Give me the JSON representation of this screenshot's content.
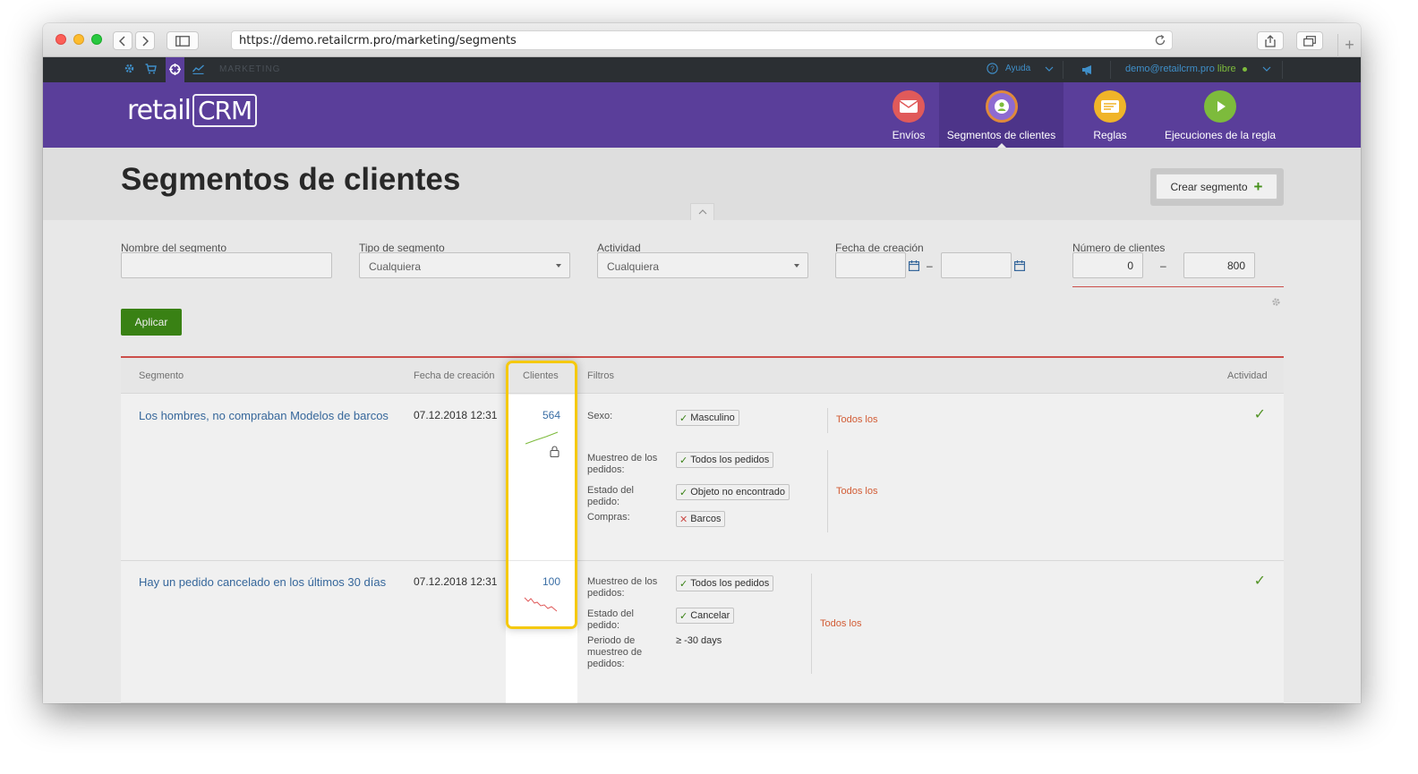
{
  "browser": {
    "url": "https://demo.retailcrm.pro/marketing/segments"
  },
  "topbar": {
    "section_label": "MARKETING",
    "help_label": "Ayuda",
    "user_email": "demo@retailcrm.pro",
    "user_plan": "libre"
  },
  "header": {
    "logo_text": "retail",
    "logo_crm": "CRM",
    "nav": [
      {
        "label": "Envíos",
        "icon": "envelope-icon",
        "color": "#e05a5a"
      },
      {
        "label": "Segmentos de clientes",
        "icon": "segments-icon",
        "color": "#8e6bd1"
      },
      {
        "label": "Reglas",
        "icon": "rules-icon",
        "color": "#f0b429"
      },
      {
        "label": "Ejecuciones de la regla",
        "icon": "play-icon",
        "color": "#7dbb3c"
      }
    ]
  },
  "page": {
    "title": "Segmentos de clientes",
    "create_button": "Crear segmento"
  },
  "filters": {
    "name_label": "Nombre del segmento",
    "name_value": "",
    "type_label": "Tipo de segmento",
    "type_value": "Cualquiera",
    "activity_label": "Actividad",
    "activity_value": "Cualquiera",
    "date_label": "Fecha de creación",
    "date_from": "",
    "date_to": "",
    "clients_label": "Número de clientes",
    "clients_min": "0",
    "clients_max": "800",
    "dash": "–",
    "apply_button": "Aplicar"
  },
  "table": {
    "headers": {
      "segment": "Segmento",
      "date": "Fecha de creación",
      "clients": "Clientes",
      "filters": "Filtros",
      "activity": "Actividad"
    },
    "rows": [
      {
        "name": "Los hombres, no compraban Modelos de barcos",
        "date": "07.12.2018 12:31",
        "clients": "564",
        "filters": {
          "sex_label": "Sexo:",
          "sex_value": "Masculino",
          "sample_label": "Muestreo de los pedidos:",
          "sample_value": "Todos los pedidos",
          "status_label": "Estado del pedido:",
          "status_value": "Objeto no encontrado",
          "purchases_label": "Compras:",
          "purchases_value": "Barcos",
          "todos_1": "Todos los",
          "todos_2": "Todos los"
        }
      },
      {
        "name": "Hay un pedido cancelado en los últimos 30 días",
        "date": "07.12.2018 12:31",
        "clients": "100",
        "filters": {
          "sample_label": "Muestreo de los pedidos:",
          "sample_value": "Todos los pedidos",
          "status_label": "Estado del pedido:",
          "status_value": "Cancelar",
          "period_label": "Periodo de muestreo de pedidos:",
          "period_value": "≥ -30 days",
          "todos_1": "Todos los"
        }
      }
    ]
  },
  "colors": {
    "brand_purple": "#5a3e9a",
    "apply_green": "#3d8a16",
    "link_blue": "#3a6ea5",
    "accent_orange": "#e0633a",
    "highlight_yellow": "#f5c90f"
  }
}
